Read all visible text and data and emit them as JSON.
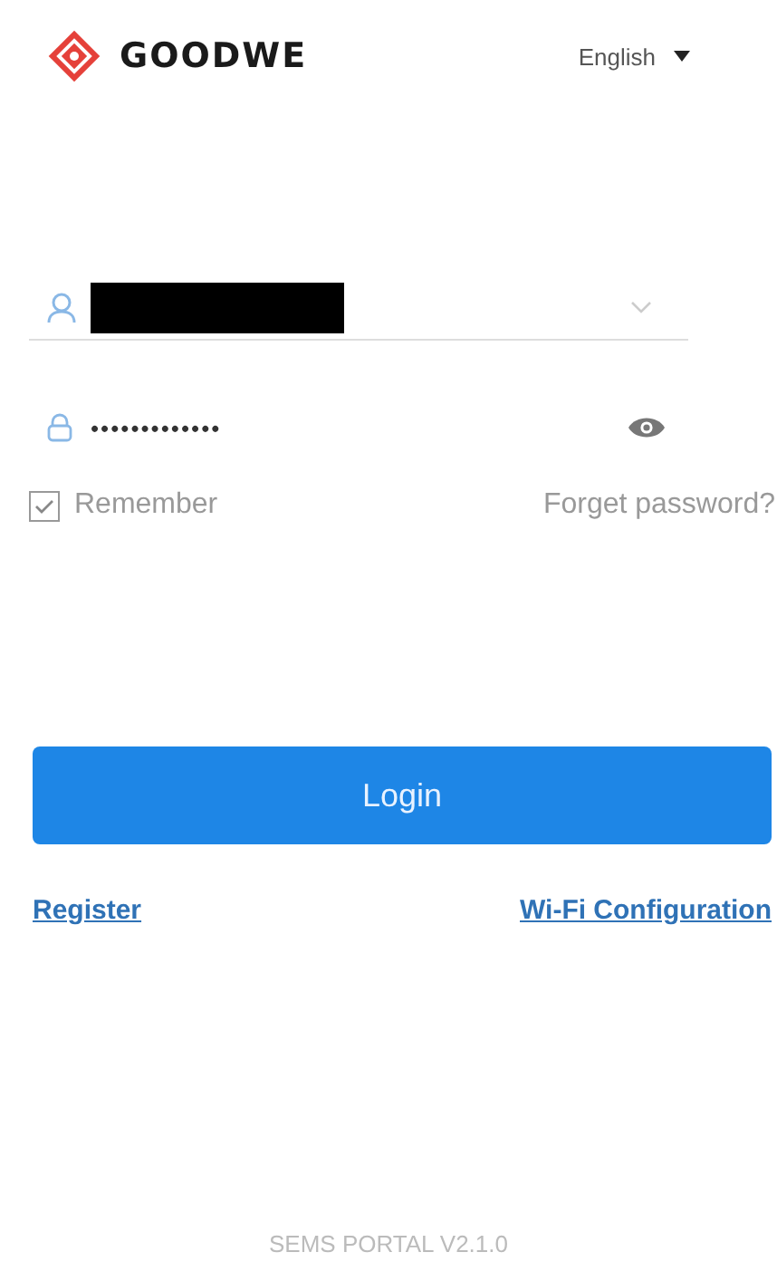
{
  "header": {
    "logo_text": "GOODWE",
    "language": "English"
  },
  "username": {
    "redacted": true
  },
  "password": {
    "value": "•••••••••••••"
  },
  "remember": {
    "label": "Remember",
    "checked": true
  },
  "forgot_link": "Forget password?",
  "login_button": "Login",
  "links": [
    "Register",
    "Wi-Fi Configuration"
  ],
  "footer": "SEMS PORTAL V2.1.0"
}
